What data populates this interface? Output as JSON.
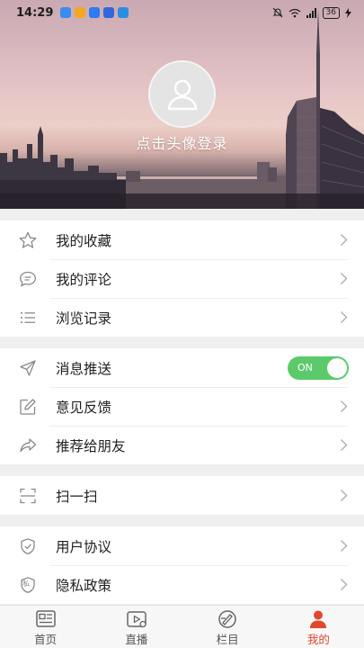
{
  "status_bar": {
    "time": "14:29",
    "battery": "36",
    "app_icon_colors": [
      "#3b8cf0",
      "#f5a623",
      "#2b7cf0",
      "#3366dd",
      "#2a8fe0"
    ]
  },
  "profile": {
    "login_prompt": "点击头像登录"
  },
  "menu": {
    "group1": [
      {
        "label": "我的收藏",
        "icon": "star-icon"
      },
      {
        "label": "我的评论",
        "icon": "comment-icon"
      },
      {
        "label": "浏览记录",
        "icon": "list-icon"
      }
    ],
    "group2": [
      {
        "label": "消息推送",
        "icon": "send-icon",
        "toggle": "ON"
      },
      {
        "label": "意见反馈",
        "icon": "edit-icon"
      },
      {
        "label": "推荐给朋友",
        "icon": "share-icon"
      }
    ],
    "group3": [
      {
        "label": "扫一扫",
        "icon": "scan-icon"
      }
    ],
    "group4": [
      {
        "label": "用户协议",
        "icon": "shield-check-icon"
      },
      {
        "label": "隐私政策",
        "icon": "privacy-shield-icon",
        "icon_text": "私"
      }
    ]
  },
  "tabbar": [
    {
      "label": "首页",
      "icon": "home-news-icon"
    },
    {
      "label": "直播",
      "icon": "live-icon"
    },
    {
      "label": "栏目",
      "icon": "column-icon"
    },
    {
      "label": "我的",
      "icon": "person-icon",
      "active": true
    }
  ],
  "colors": {
    "accent": "#e0492f",
    "toggle_on": "#5cca6b",
    "separator": "#ececec"
  }
}
